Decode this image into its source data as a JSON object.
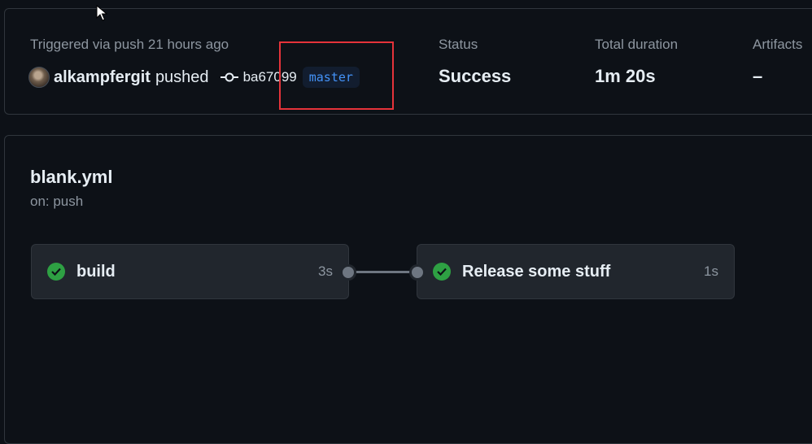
{
  "summary": {
    "trigger_text": "Triggered via push 21 hours ago",
    "user": "alkampfergit",
    "action": "pushed",
    "commit_sha": "ba67099",
    "branch": "master",
    "status_label": "Status",
    "status_value": "Success",
    "duration_label": "Total duration",
    "duration_value": "1m 20s",
    "artifacts_label": "Artifacts",
    "artifacts_value": "–"
  },
  "workflow": {
    "file": "blank.yml",
    "trigger": "on: push",
    "jobs": [
      {
        "name": "build",
        "duration": "3s",
        "status": "success"
      },
      {
        "name": "Release some stuff",
        "duration": "1s",
        "status": "success"
      }
    ]
  },
  "colors": {
    "background": "#0d1117",
    "success": "#2ea043",
    "branch_text": "#4493f8",
    "highlight": "#e5333a"
  },
  "icons": [
    "commit-icon",
    "check-circle-icon",
    "mouse-cursor-icon",
    "avatar"
  ]
}
